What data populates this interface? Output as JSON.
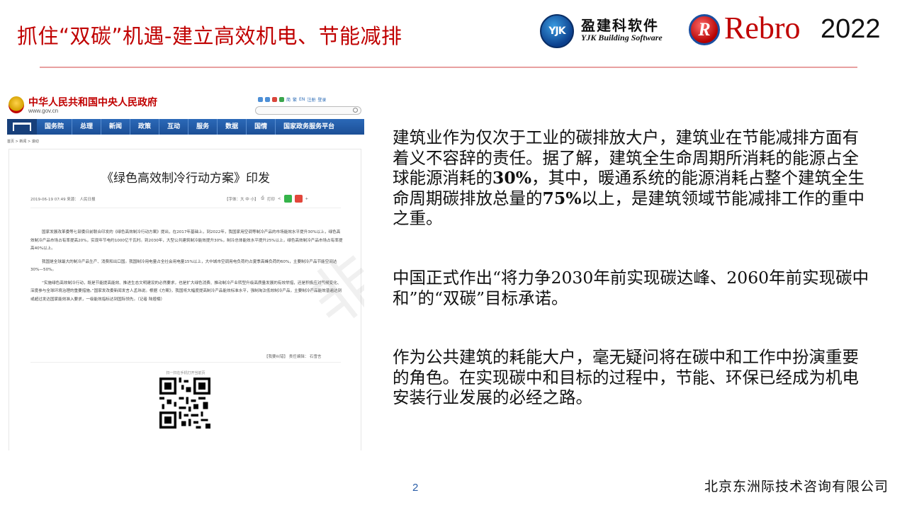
{
  "slide": {
    "title": "抓住“双碳”机遇-建立高效机电、节能减排",
    "page_number": "2",
    "company": "北京东洲际技术咨询有限公司"
  },
  "logos": {
    "yjk_badge": "YJK",
    "yjk_cn": "盈建科软件",
    "yjk_en": "YJK Building Software",
    "rebro_badge": "R",
    "rebro_name": "Rebro",
    "year": "2022"
  },
  "webpage": {
    "site_name": "中华人民共和国中央人民政府",
    "site_url": "www.gov.cn",
    "util_links": [
      "简",
      "繁",
      "EN",
      "注册",
      "登录"
    ],
    "nav_items": [
      "国务院",
      "总理",
      "新闻",
      "政策",
      "互动",
      "服务",
      "数据",
      "国情",
      "国家政务服务平台"
    ],
    "breadcrumb": [
      "首页",
      "新闻",
      "滚动"
    ],
    "article_title": "《绿色高效制冷行动方案》印发",
    "article_meta": "2019-06-19 07:49   来源： 人民日报",
    "font_tools": "【字体：大 中 小】",
    "print_label": "打印",
    "paragraphs": [
      "国家发展改革委等七部委日前联合印发的《绿色高效制冷行动方案》提出，在2017年基础上，到2022年，我国家用空调等制冷产品的市场能效水平提升30%以上，绿色高效制冷产品市场占有率提高20%，实现年节电约1000亿千瓦时。到2030年，大型公共建筑制冷能效提升30%，制冷总体能效水平提升25%以上，绿色高效制冷产品市场占有率提高40%以上。",
      "我国是全球最大的制冷产品生产、消费和出口国。我国制冷用电量占全社会用电量15%以上，大中城市空调用电负荷约占夏季高峰负荷的60%，主要制冷产品节能空间达30%—50%。",
      "“实施绿色高效制冷行动，既是节能提高能效、推进生态文明建设的必然要求，也是扩大绿色消费、推动制冷产业转型升级高质量发展的有效举措，还是积极应对气候变化、深度参与全球环境治理的重要措施。”国家发改委新闻发言人孟玮说。根据《方案》，我国将大幅度提高制冷产品能效标准水平，强制淘汰低效制冷产品，主要制冷产品能效普遍达到或超过发达国家能效准入要求，一级能效指标达到国际领先。（记者 陆娅楠）"
    ],
    "editor_line": "【我要纠错】     责任编辑： 石雪言",
    "qr_caption": "扫一扫在手机打开当前页"
  },
  "watermark": "非会员",
  "content": {
    "p1_a": "建筑业作为仅次于工业的碳排放大户，建筑业在节能减排方面有着义不容辞的责任。据了解，建筑全生命周期所消耗的能源占全球能源消耗的",
    "p1_b": "30%",
    "p1_c": "，其中，暖通系统的能源消耗占整个建筑全生命周期碳排放总量的",
    "p1_d": "75%",
    "p1_e": "以上，是建筑领域节能减排工作的重中之重。",
    "p2": "中国正式作出“将力争2030年前实现碳达峰、2060年前实现碳中和”的“双碳”目标承诺。",
    "p3": "作为公共建筑的耗能大户，毫无疑问将在碳中和工作中扮演重要的角色。在实现碳中和目标的过程中，节能、环保已经成为机电安装行业发展的必经之路。"
  }
}
